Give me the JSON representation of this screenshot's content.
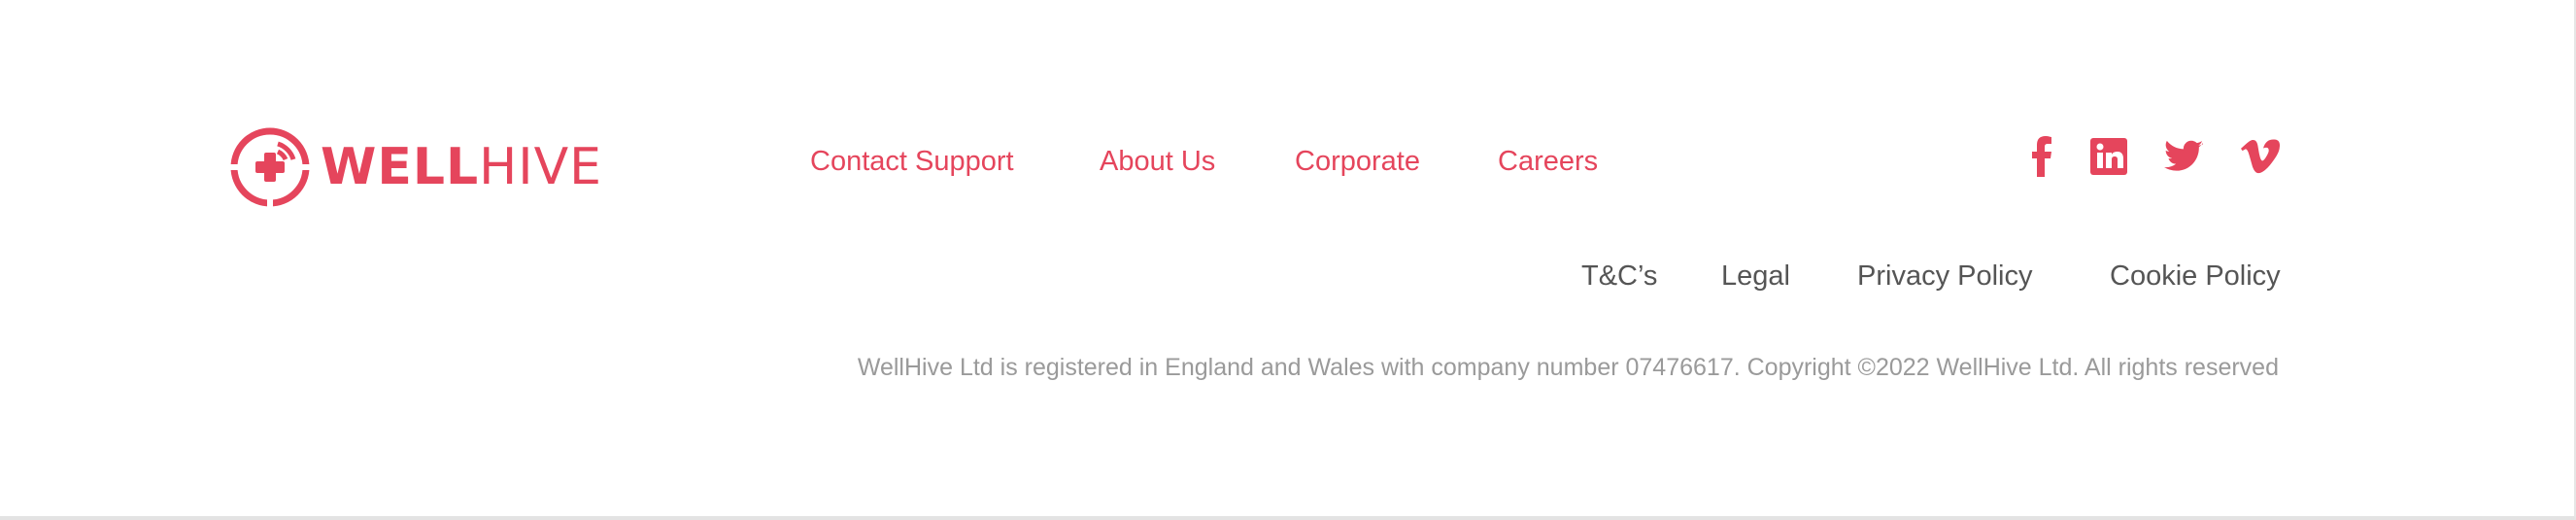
{
  "colors": {
    "accent": "#e5455c",
    "legal_text": "#555555",
    "copyright_text": "#9a9a9a"
  },
  "logo": {
    "wordmark_bold": "WELL",
    "wordmark_light": "HIVE",
    "icon": "medical-cross-target-icon"
  },
  "nav": {
    "items": [
      {
        "label": "Contact Support"
      },
      {
        "label": "About Us"
      },
      {
        "label": "Corporate"
      },
      {
        "label": "Careers"
      }
    ]
  },
  "social": {
    "icons": [
      "facebook-icon",
      "linkedin-icon",
      "twitter-icon",
      "vimeo-icon"
    ]
  },
  "legal": {
    "items": [
      {
        "label": "T&C’s"
      },
      {
        "label": "Legal"
      },
      {
        "label": "Privacy Policy"
      },
      {
        "label": "Cookie Policy"
      }
    ]
  },
  "copyright": "WellHive Ltd is registered in England and Wales with company number 07476617. Copyright ©2022 WellHive Ltd. All rights reserved"
}
